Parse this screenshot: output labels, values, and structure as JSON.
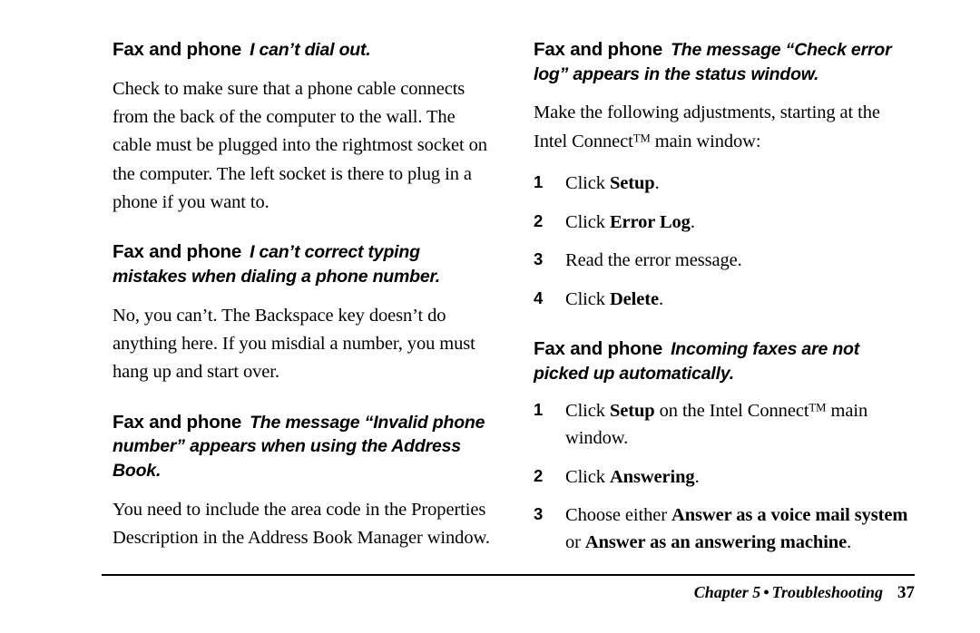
{
  "page": {
    "number": "37",
    "footer_chapter": "Chapter 5",
    "footer_separator": "•",
    "footer_section": "Troubleshooting"
  },
  "left_column": {
    "sections": [
      {
        "heading_lead": "Fax and phone",
        "heading_question": "I can’t dial out.",
        "body": "Check to make sure that a phone cable connects from the back of the computer to the wall. The cable must be plugged into the rightmost socket on the computer. The left socket is there to plug in a phone if you want to."
      },
      {
        "heading_lead": "Fax and phone",
        "heading_question": "I can’t correct typing mistakes when dialing a phone number.",
        "body": "No, you can’t. The Backspace key doesn’t do anything here. If you misdial a number, you must hang up and start over."
      },
      {
        "heading_lead": "Fax and phone",
        "heading_question": "The message “Invalid phone number” appears when using the Address Book.",
        "body": "You need to include the area code in the Properties Description in the Address Book Manager window."
      }
    ]
  },
  "right_column": {
    "section_error_log": {
      "heading_lead": "Fax and phone",
      "heading_question": "The message “Check error log” appears in the status window.",
      "intro_before_tm": "Make the following adjustments, starting at the Intel Connect",
      "intro_tm": "TM",
      "intro_after_tm": " main window:",
      "steps": [
        {
          "num": "1",
          "before": "Click ",
          "bold": "Setup",
          "after": "."
        },
        {
          "num": "2",
          "before": "Click ",
          "bold": "Error Log",
          "after": "."
        },
        {
          "num": "3",
          "before": "Read the error message.",
          "bold": "",
          "after": ""
        },
        {
          "num": "4",
          "before": "Click ",
          "bold": "Delete",
          "after": "."
        }
      ]
    },
    "section_incoming_faxes": {
      "heading_lead": "Fax and phone",
      "heading_question": "Incoming faxes are not picked up automatically.",
      "step1_before": "Click ",
      "step1_bold": "Setup",
      "step1_mid": " on the Intel Connect",
      "step1_tm": "TM",
      "step1_after": " main window.",
      "step1_num": "1",
      "step2_num": "2",
      "step2_before": "Click ",
      "step2_bold": "Answering",
      "step2_after": ".",
      "step3_num": "3",
      "step3_before": "Choose either ",
      "step3_bold1": "Answer as a voice mail system",
      "step3_mid": " or ",
      "step3_bold2": "Answer as an answering machine",
      "step3_after": "."
    }
  }
}
